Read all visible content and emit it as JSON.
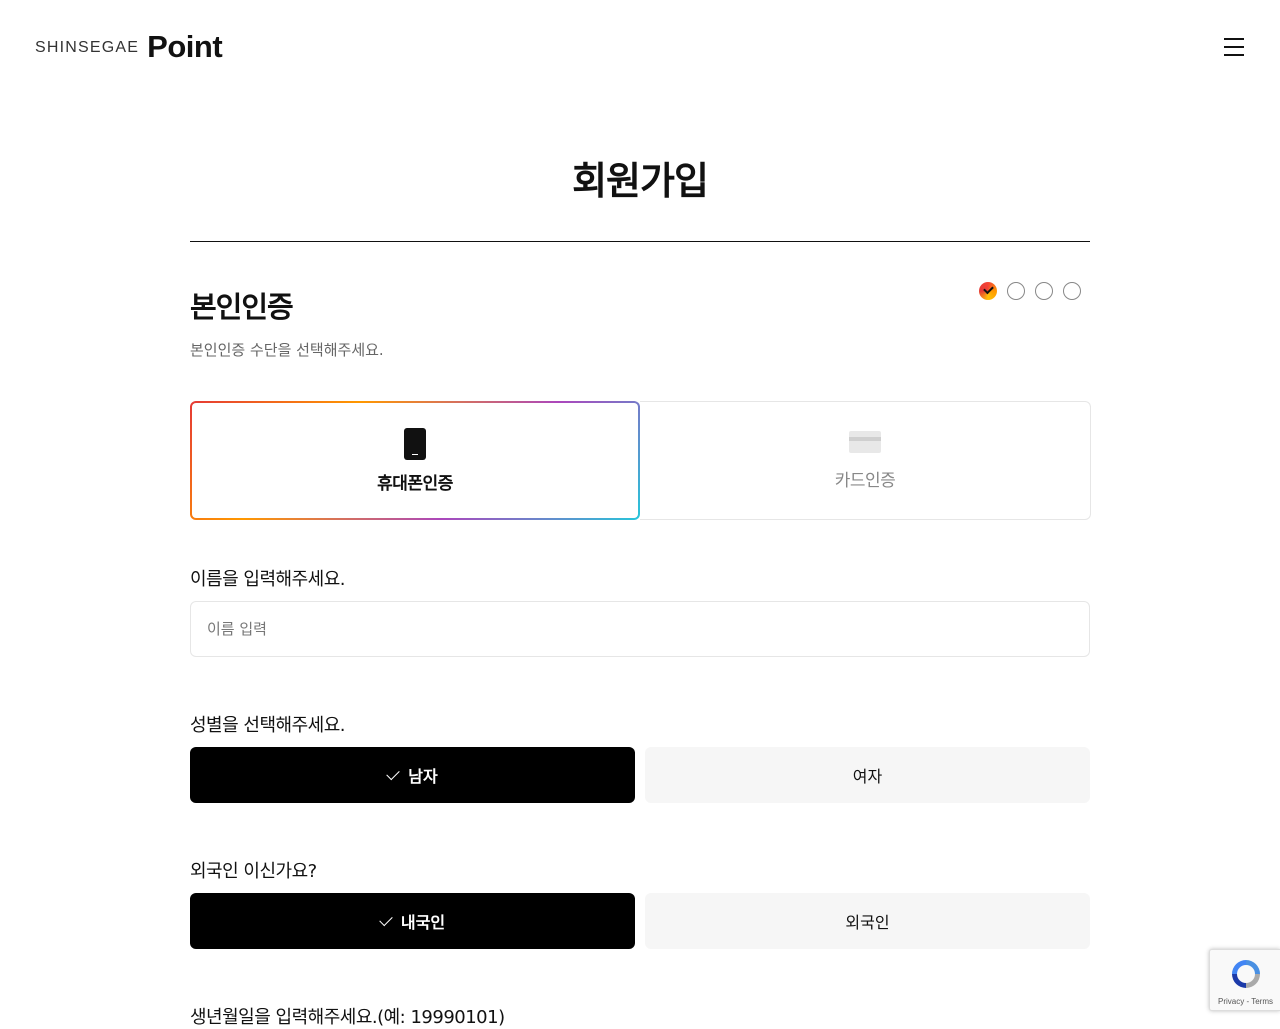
{
  "header": {
    "logo_small": "SHINSEGAE",
    "logo_big": "Point",
    "menu_icon": "hamburger-icon"
  },
  "page": {
    "title": "회원가입"
  },
  "section": {
    "title": "본인인증",
    "description": "본인인증 수단을 선택해주세요.",
    "steps_total": 4,
    "steps_current": 1
  },
  "auth_methods": [
    {
      "label": "휴대폰인증",
      "icon": "mobile-phone-icon",
      "selected": true
    },
    {
      "label": "카드인증",
      "icon": "credit-card-icon",
      "selected": false
    }
  ],
  "name_field": {
    "label": "이름을 입력해주세요.",
    "placeholder": "이름 입력",
    "value": ""
  },
  "gender": {
    "label": "성별을 선택해주세요.",
    "options": [
      {
        "label": "남자",
        "selected": true
      },
      {
        "label": "여자",
        "selected": false
      }
    ]
  },
  "nationality": {
    "label": "외국인 이신가요?",
    "options": [
      {
        "label": "내국인",
        "selected": true
      },
      {
        "label": "외국인",
        "selected": false
      }
    ]
  },
  "birth_field": {
    "label": "생년월일을 입력해주세요.(예: 19990101)"
  },
  "recaptcha": {
    "footer": "Privacy - Terms"
  },
  "colors": {
    "accent": "#000000",
    "unselected_bg": "#f6f6f6",
    "gradient_start": "#e53935",
    "gradient_end": "#26c6da"
  }
}
